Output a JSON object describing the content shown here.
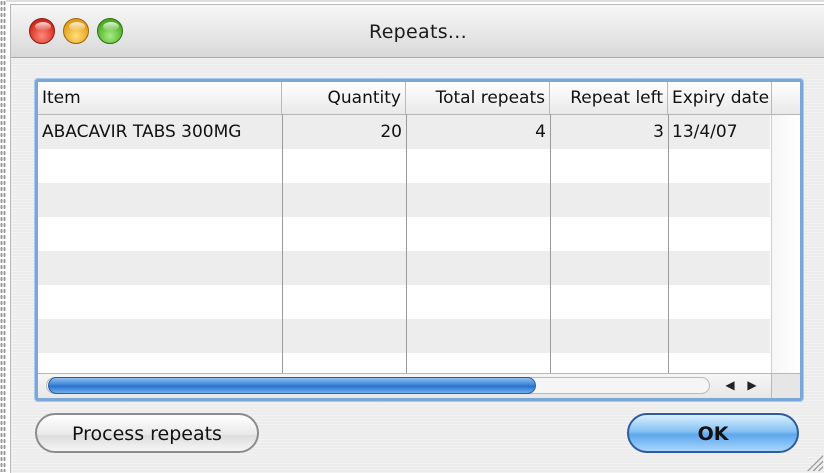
{
  "window": {
    "title": "Repeats..."
  },
  "table": {
    "columns": [
      "Item",
      "Quantity",
      "Total repeats",
      "Repeat left",
      "Expiry date"
    ],
    "rows": [
      {
        "item": "ABACAVIR TABS 300MG",
        "quantity": "20",
        "total_repeats": "4",
        "repeat_left": "3",
        "expiry_date": "13/4/07"
      }
    ]
  },
  "scroll": {
    "left_arrow": "◀",
    "right_arrow": "▶"
  },
  "buttons": {
    "process_repeats": "Process repeats",
    "ok": "OK"
  },
  "colors": {
    "selection_blue": "#3f86d8",
    "focus_ring": "#7aa7d8"
  }
}
